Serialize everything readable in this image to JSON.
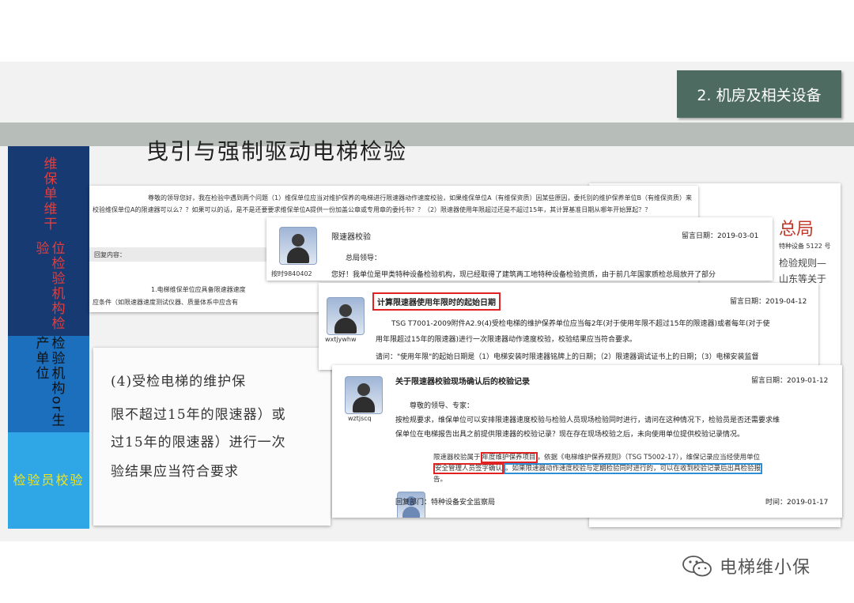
{
  "section_tag": "2. 机房及相关设备",
  "slide_title": "曳引与强制驱动电梯检验",
  "sidebar": [
    {
      "label": "维保单维干"
    },
    {
      "label": "位检验机构检验"
    },
    {
      "label": "检验机构or生产单位"
    },
    {
      "label": "检验员校验"
    }
  ],
  "doc1": {
    "question": "尊敬的领导您好，我在检验中遇到两个问题（1）维保单位应当对维护保养的电梯进行限速器动作速度校验，如果维保单位A（有维保资质）因某些原因，委托别的维护保养单位B（有维保资质）来校验维保单位A的限速器可以么？？如果可以的话，是不是还要要求维保单位A提供一份加盖公章或专用章的委托书？？（2）限速器使用年限超过还是不超过15年，其计算基准日期从哪年开始算起？？",
    "reply_label": "回复内容：",
    "reply_text": "1.电梯维保单位应具备限速器速度",
    "reply_text2": "应条件（如限速器速度测试仪器、质量体系中应含有"
  },
  "handwritten": {
    "line1": "(4)受检电梯的维护保",
    "line2": "限不超过15年的限速器）或",
    "line3": "过15年的限速器）进行一次",
    "line4": "验结果应当符合要求"
  },
  "right_doc": {
    "header": "总局",
    "ref": "特种设备 5122 号",
    "line1": "检验规则—",
    "line2": "山东等关于"
  },
  "msg1": {
    "user": "按时9840402",
    "title": "限速器校验",
    "date_label": "留言日期：",
    "date": "2019-03-01",
    "greeting": "总局领导：",
    "body": "您好！我单位是甲类特种设备检验机构，现已经取得了建筑两工地特种设备检验资质，由于前几年国家质检总局放开了部分"
  },
  "msg2": {
    "user": "wxtjywhw",
    "title": "计算限速器使用年限时的起始日期",
    "date_label": "留言日期：",
    "date": "2019-04-12",
    "body1": "TSG T7001-2009附件A2.9(4)受检电梯的维护保养单位应当每2年(对于使用年限不超过15年的限速器)或者每年(对于使",
    "body2": "用年限超过15年的限速器)进行一次限速器动作速度校验，校验结果应当符合要求。",
    "body3": "请问：\"使用年限\"的起始日期是（1）电梯安装时限速器铭牌上的日期；（2）限速器调试证书上的日期；（3）电梯安装监督"
  },
  "msg3": {
    "user": "wztjscq",
    "title": "关于限速器校验现场确认后的校验记录",
    "date_label": "留言日期：",
    "date": "2019-01-12",
    "greeting": "尊敬的领导、专家：",
    "body1": "按检规要求，维保单位可以安排限速器速度校验与检验人员现场检验同时进行，请问在这种情况下，检验员是否还需要求维",
    "body2": "保单位在电梯报告出具之前提供限速器的校验记录？现在存在现场校验之后，未向使用单位提供校验记录情况。",
    "answer_a": "限速器校验属于",
    "answer_b": "年度维护保养项目",
    "answer_c": "，依据《电梯维护保养规则》（TSG T5002-17），维保记录应当经使用单位",
    "answer_d": "安全管理人员签字确认",
    "answer_e": "。如果限速器动作速度校验与定期检验同时进行的，可以在收到校验记录后出具检验报",
    "answer_f": "告。",
    "dept_label": "回复部门：",
    "dept": "特种设备安全监察局",
    "time_label": "时间：",
    "time": "2019-01-17"
  },
  "watermark": "电梯维小保"
}
